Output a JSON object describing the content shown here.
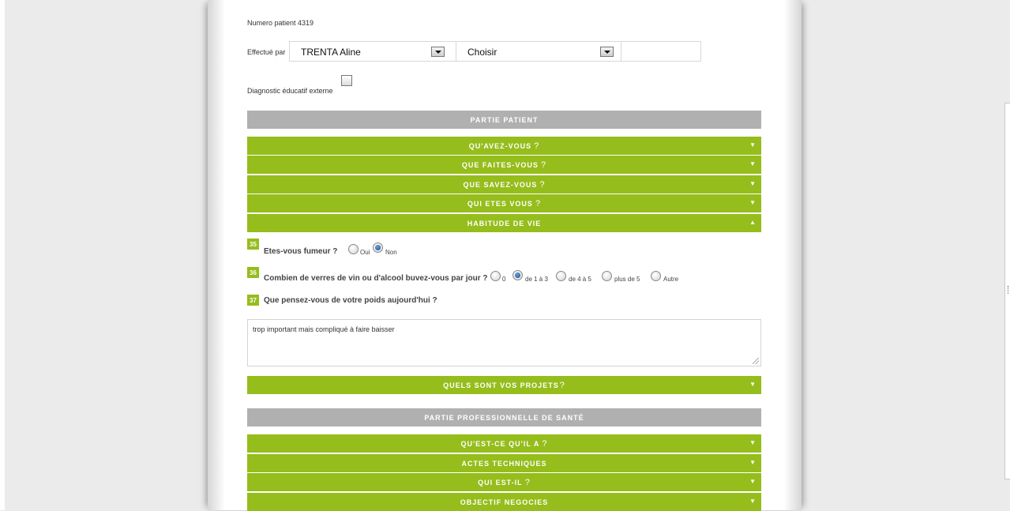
{
  "patient_label": "Numero patient 4319",
  "effectue_par": {
    "label": "Effectué par",
    "select1_value": "TRENTA Aline",
    "select2_value": "Choisir"
  },
  "diagnostic_label": "Diagnostic éducatif externe",
  "sections": {
    "partie_patient": "PARTIE PATIENT",
    "quavez": "QU'AVEZ-VOUS",
    "quefaites": "QUE FAITES-VOUS",
    "quesavez": "QUE SAVEZ-VOUS",
    "quietes": "QUI ETES VOUS",
    "habitude": "HABITUDE DE VIE",
    "projets": "QUELS SONT VOS PROJETS",
    "partie_pro": "PARTIE PROFESSIONNELLE DE SANTÉ",
    "questcequila": "QU'EST-CE QU'IL A",
    "actes": "ACTES TECHNIQUES",
    "quiestil": "QUI EST-IL",
    "objectif": "OBJECTIF NEGOCIES"
  },
  "question_mark": "?",
  "arrow_down": "▼",
  "arrow_up": "▲",
  "questions": {
    "q35": {
      "num": "35",
      "text": "Etes-vous fumeur ?",
      "options": [
        "Oui",
        "Non"
      ],
      "selected": "Non"
    },
    "q36": {
      "num": "36",
      "text": "Combien de verres de vin ou d'alcool buvez-vous par jour ?",
      "options": [
        "0",
        "de 1 à 3",
        "de 4 à 5",
        "plus de 5",
        "Autre"
      ],
      "selected": "de 1 à 3"
    },
    "q37": {
      "num": "37",
      "text": "Que pensez-vous de votre poids aujourd'hui ?",
      "answer": "trop important mais compliqué à faire baisser"
    }
  }
}
